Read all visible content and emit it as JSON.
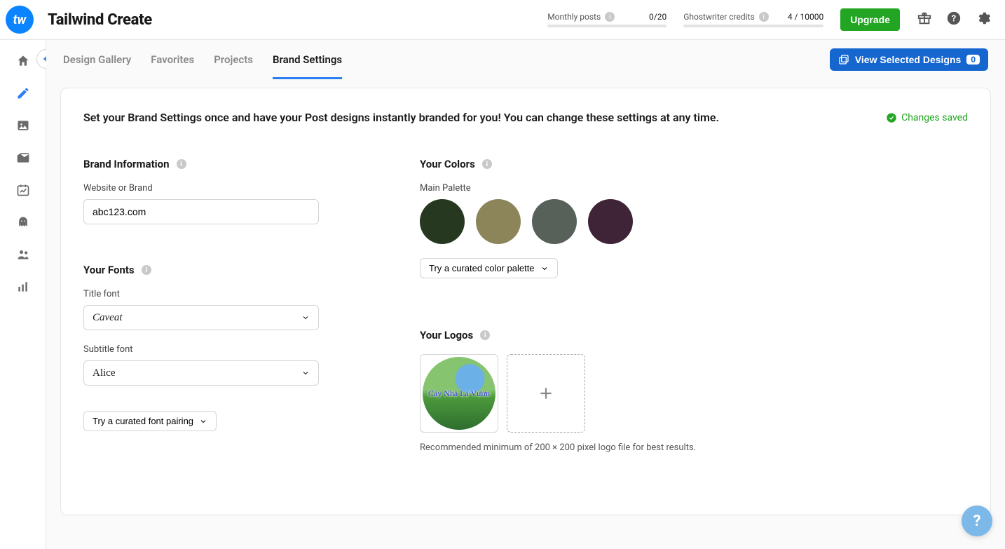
{
  "header": {
    "logo_text": "tw",
    "app_title": "Tailwind Create",
    "meters": {
      "posts": {
        "label": "Monthly posts",
        "value": "0/20",
        "fill_pct": 0
      },
      "credits": {
        "label": "Ghostwriter credits",
        "value": "4 / 10000",
        "fill_pct": 0
      }
    },
    "upgrade_label": "Upgrade",
    "icons": [
      "gift-icon",
      "help-icon",
      "gear-icon"
    ]
  },
  "sidenav": {
    "items": [
      {
        "name": "home-icon"
      },
      {
        "name": "pencil-icon",
        "active": true
      },
      {
        "name": "image-icon"
      },
      {
        "name": "mail-icon"
      },
      {
        "name": "calendar-chart-icon"
      },
      {
        "name": "ghost-icon"
      },
      {
        "name": "people-icon"
      },
      {
        "name": "bar-chart-icon"
      }
    ],
    "collapse_name": "collapse-toggle-icon"
  },
  "tabs": {
    "items": [
      {
        "label": "Design Gallery"
      },
      {
        "label": "Favorites"
      },
      {
        "label": "Projects"
      },
      {
        "label": "Brand Settings",
        "active": true
      }
    ],
    "view_selected": {
      "label": "View Selected Designs",
      "count": "0"
    }
  },
  "panel": {
    "description": "Set your Brand Settings once and have your Post designs instantly branded for you! You can change these settings at any time.",
    "saved_label": "Changes saved"
  },
  "brand_info": {
    "title": "Brand Information",
    "website_label": "Website or Brand",
    "website_value": "abc123.com"
  },
  "fonts": {
    "title": "Your Fonts",
    "title_font_label": "Title font",
    "title_font_value": "Caveat",
    "subtitle_font_label": "Subtitle font",
    "subtitle_font_value": "Alice",
    "pairing_btn": "Try a curated font pairing"
  },
  "colors": {
    "title": "Your Colors",
    "palette_label": "Main Palette",
    "swatches": [
      "#26381f",
      "#8c8559",
      "#576059",
      "#3f2336"
    ],
    "palette_btn": "Try a curated color palette"
  },
  "logos": {
    "title": "Your Logos",
    "logo_text": "Cây Nhà Lá Vườn",
    "hint": "Recommended minimum of 200 × 200 pixel logo file for best results."
  }
}
